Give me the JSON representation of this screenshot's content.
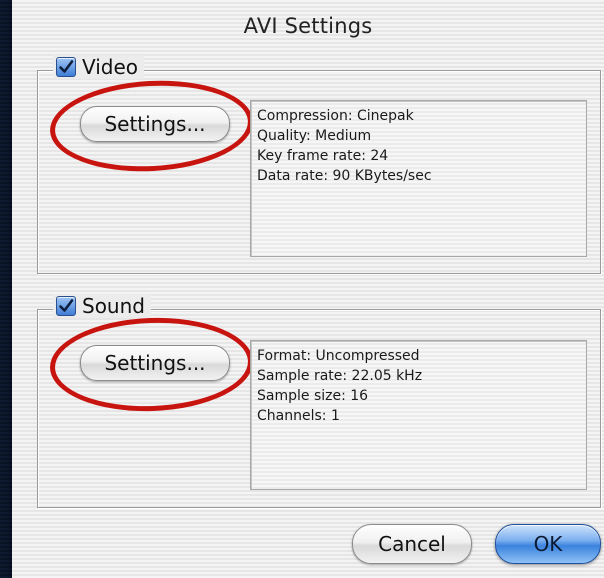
{
  "window": {
    "title": "AVI Settings"
  },
  "video": {
    "checkbox_checked": true,
    "label": "Video",
    "settings_button": "Settings...",
    "info": [
      "Compression: Cinepak",
      "Quality: Medium",
      "Key frame rate: 24",
      "Data rate: 90 KBytes/sec"
    ]
  },
  "sound": {
    "checkbox_checked": true,
    "label": "Sound",
    "settings_button": "Settings...",
    "info": [
      "Format: Uncompressed",
      "Sample rate: 22.05 kHz",
      "Sample size: 16",
      "Channels: 1"
    ]
  },
  "buttons": {
    "cancel": "Cancel",
    "ok": "OK"
  },
  "colors": {
    "highlight_ring": "#c8140f",
    "checkbox_blue": "#3f7dd6",
    "default_button_blue": "#3b83de"
  }
}
